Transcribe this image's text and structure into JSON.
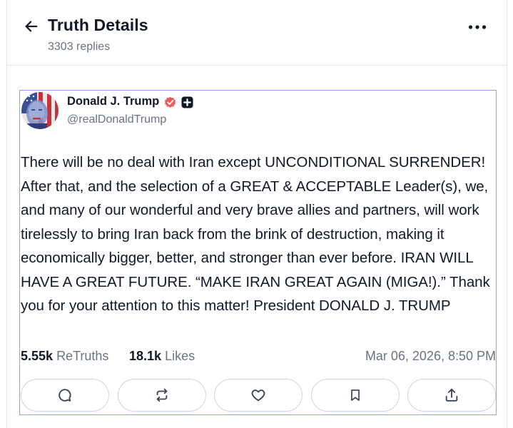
{
  "header": {
    "title": "Truth Details",
    "replies": "3303 replies",
    "back_icon": "arrow-left-icon",
    "more_icon": "more-horizontal-icon"
  },
  "post": {
    "author_name": "Donald J. Trump",
    "author_handle": "@realDonaldTrump",
    "verified_icon": "verified-badge-icon",
    "verified_color": "#f05a5a",
    "extra_badge_icon": "plus-badge-icon",
    "text": "There will be no deal with Iran except UNCONDITIONAL SURRENDER! After that, and the selection of a GREAT & ACCEPTABLE Leader(s), we, and many of our wonderful and very brave allies and partners, will work tirelessly to bring Iran back from the brink of destruction, making it economically bigger, better, and stronger than ever before. IRAN WILL HAVE A GREAT FUTURE. “MAKE IRAN GREAT AGAIN (MIGA!).” Thank you for your attention to this matter! President DONALD J. TRUMP",
    "retruths_count": "5.55k",
    "retruths_label": "ReTruths",
    "likes_count": "18.1k",
    "likes_label": "Likes",
    "timestamp": "Mar 06, 2026, 8:50 PM"
  },
  "actions": [
    {
      "name": "reply",
      "icon": "comment-icon"
    },
    {
      "name": "retruth",
      "icon": "repost-icon"
    },
    {
      "name": "like",
      "icon": "heart-icon"
    },
    {
      "name": "bookmark",
      "icon": "bookmark-icon"
    },
    {
      "name": "share",
      "icon": "share-icon"
    }
  ],
  "colors": {
    "post_border": "#8fa3ee",
    "text_primary": "#111827",
    "text_secondary": "#6b7280"
  }
}
